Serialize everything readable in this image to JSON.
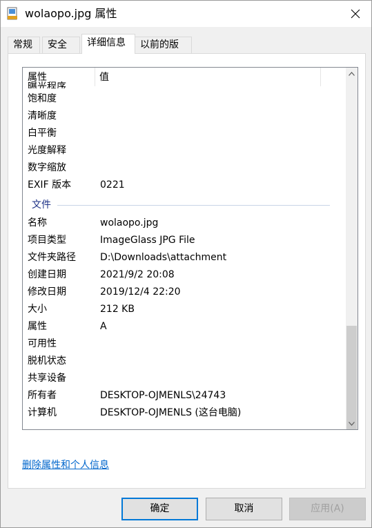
{
  "window": {
    "title": "wolaopo.jpg 属性",
    "icon": "image-file-icon",
    "close_icon": "close-icon"
  },
  "tabs": [
    {
      "label": "常规",
      "active": false
    },
    {
      "label": "安全",
      "active": false
    },
    {
      "label": "详细信息",
      "active": true
    },
    {
      "label": "以前的版本",
      "active": false
    }
  ],
  "list": {
    "columns": {
      "property": "属性",
      "value": "值"
    },
    "partial_top": "曝光程序",
    "rows_before_group": [
      {
        "key": "饱和度",
        "value": ""
      },
      {
        "key": "清晰度",
        "value": ""
      },
      {
        "key": "白平衡",
        "value": ""
      },
      {
        "key": "光度解释",
        "value": ""
      },
      {
        "key": "数字缩放",
        "value": ""
      },
      {
        "key": "EXIF 版本",
        "value": "0221"
      }
    ],
    "group_label": "文件",
    "rows_after_group": [
      {
        "key": "名称",
        "value": "wolaopo.jpg"
      },
      {
        "key": "项目类型",
        "value": "ImageGlass JPG File"
      },
      {
        "key": "文件夹路径",
        "value": "D:\\Downloads\\attachment"
      },
      {
        "key": "创建日期",
        "value": "2021/9/2 20:08"
      },
      {
        "key": "修改日期",
        "value": "2019/12/4 22:20"
      },
      {
        "key": "大小",
        "value": "212 KB"
      },
      {
        "key": "属性",
        "value": "A"
      },
      {
        "key": "可用性",
        "value": ""
      },
      {
        "key": "脱机状态",
        "value": ""
      },
      {
        "key": "共享设备",
        "value": ""
      },
      {
        "key": "所有者",
        "value": "DESKTOP-OJMENLS\\24743"
      },
      {
        "key": "计算机",
        "value": "DESKTOP-OJMENLS (这台电脑)"
      }
    ]
  },
  "link": "删除属性和个人信息",
  "buttons": {
    "ok": "确定",
    "cancel": "取消",
    "apply": "应用(A)"
  },
  "colors": {
    "accent": "#0078d7",
    "link": "#0066cc",
    "group_text": "#1e3287"
  }
}
